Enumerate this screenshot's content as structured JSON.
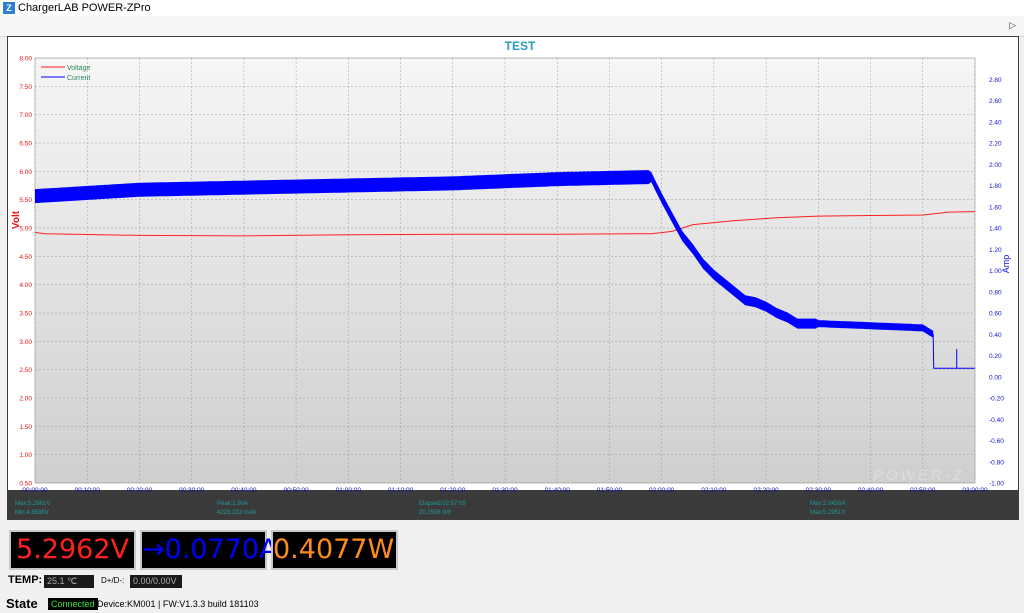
{
  "app": {
    "title": "ChargerLAB POWER-ZPro",
    "icon": "app-logo-icon"
  },
  "colors": {
    "voltage": "#ff2020",
    "current": "#0000ff",
    "power": "#ff8c1a",
    "connected": "#2fe02f"
  },
  "chart_data": {
    "type": "line",
    "title": "TEST",
    "xlabel": "",
    "ylabel": "Volt",
    "y2label": "Amp",
    "ylim": [
      0.5,
      8.0
    ],
    "y2lim": [
      -1.0,
      3.0
    ],
    "yticks": [
      "0.50",
      "1.00",
      "1.50",
      "2.00",
      "2.50",
      "3.00",
      "3.50",
      "4.00",
      "4.50",
      "5.00",
      "5.50",
      "6.00",
      "6.50",
      "7.00",
      "7.50",
      "8.00"
    ],
    "y2ticks": [
      "-1.00",
      "-0.80",
      "-0.60",
      "-0.40",
      "-0.20",
      "0.00",
      "0.20",
      "0.40",
      "0.60",
      "0.80",
      "1.00",
      "1.20",
      "1.40",
      "1.60",
      "1.80",
      "2.00",
      "2.20",
      "2.40",
      "2.60",
      "2.80"
    ],
    "xticks": [
      "00:00:00",
      "00:10:00",
      "00:20:00",
      "00:30:00",
      "00:40:00",
      "00:50:00",
      "01:00:00",
      "01:10:00",
      "01:20:00",
      "01:30:00",
      "01:40:00",
      "01:50:00",
      "02:00:00",
      "02:10:00",
      "02:20:00",
      "02:30:00",
      "02:40:00",
      "02:50:00",
      "03:00:00"
    ],
    "xlim_minutes": [
      0,
      180
    ],
    "grid": true,
    "legend_position": "top-left",
    "series": [
      {
        "name": "Voltage",
        "axis": "left",
        "x_minutes": [
          0,
          2,
          20,
          40,
          60,
          80,
          100,
          118,
          122,
          126,
          134,
          142,
          150,
          160,
          170,
          175,
          180
        ],
        "values": [
          4.92,
          4.9,
          4.87,
          4.86,
          4.88,
          4.89,
          4.89,
          4.9,
          4.94,
          5.06,
          5.13,
          5.18,
          5.21,
          5.22,
          5.23,
          5.28,
          5.29
        ]
      },
      {
        "name": "Current",
        "axis": "right",
        "x_minutes": [
          0,
          20,
          40,
          60,
          80,
          100,
          118,
          120,
          122,
          124,
          126,
          128,
          130,
          132,
          134,
          136,
          138,
          140,
          142,
          144,
          146,
          150,
          160,
          170,
          172,
          172.1,
          180
        ],
        "values": [
          1.7,
          1.76,
          1.78,
          1.8,
          1.82,
          1.86,
          1.88,
          1.68,
          1.5,
          1.32,
          1.2,
          1.06,
          0.96,
          0.88,
          0.8,
          0.72,
          0.7,
          0.66,
          0.6,
          0.56,
          0.5,
          0.5,
          0.48,
          0.46,
          0.4,
          0.08,
          0.08
        ]
      }
    ],
    "annotations": [
      "POWER-Z"
    ],
    "info_bar": [
      "Max:5.2961V",
      "Min:4.8585V",
      "Peak:1.90A",
      "4228.233 mAh",
      "Elapsed:02:57:09",
      "20.3506 Wh",
      "Max:2.0456A",
      "Max:5.2951V"
    ]
  },
  "readouts": {
    "voltage": "5.2962V",
    "current": "→0.0770A",
    "power": "0.4077W"
  },
  "temp": {
    "label": "TEMP:",
    "value": "25.1 ℃",
    "dpdm_label": "D+/D-:",
    "dpdm_value": "0.00/0.00V"
  },
  "status": {
    "label": "State",
    "connection": "Connected",
    "device": "Device:KM001",
    "firmware": "| FW:V1.3.3 build 181103"
  }
}
